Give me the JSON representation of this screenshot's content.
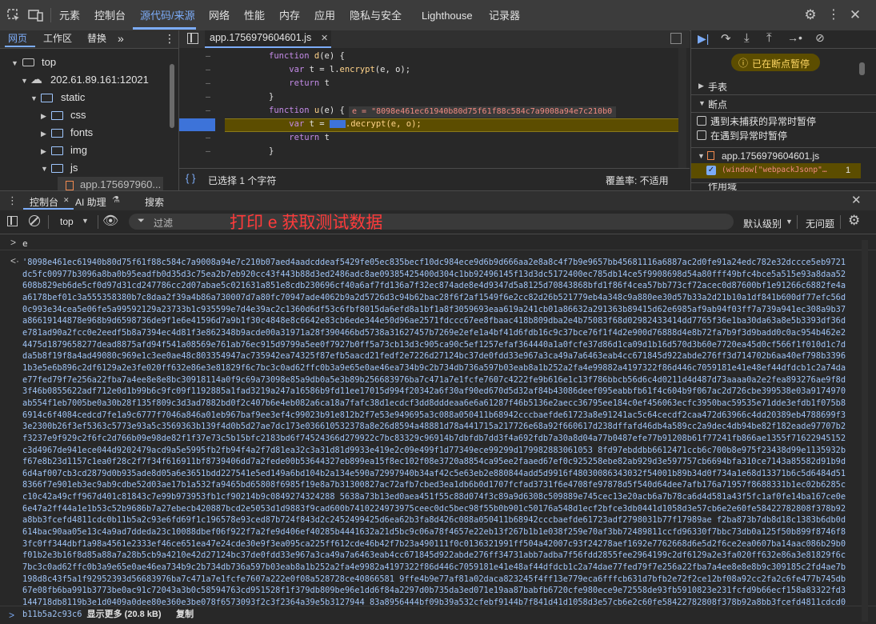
{
  "top_tabs": [
    "元素",
    "控制台",
    "源代码/来源",
    "网络",
    "性能",
    "内存",
    "应用",
    "隐私与安全",
    "Lighthouse",
    "记录器"
  ],
  "nav_tabs": [
    "网页",
    "工作区",
    "替换"
  ],
  "tree": {
    "top": "top",
    "host": "202.61.89.161:12021",
    "static": "static",
    "css": "css",
    "fonts": "fonts",
    "img": "img",
    "js": "js",
    "file": "app.175697960..."
  },
  "editor": {
    "file_tab": "app.1756979604601.js",
    "lines": [
      {
        "kw": "function ",
        "fn": "d",
        "rest": "(e) {"
      },
      {
        "ind": "    ",
        "kw": "var ",
        "rest": "t = l.",
        "fn2": "encrypt",
        "rest2": "(e, o);"
      },
      {
        "ind": "    ",
        "kw": "return ",
        "rest": "t"
      },
      {
        "rest": "}"
      },
      {
        "kw": "function ",
        "fn": "u",
        "rest": "(e) {"
      },
      {
        "ind": "    ",
        "kw": "var ",
        "rest": "t = ",
        "rest2": ".decrypt(e, o);"
      },
      {
        "ind": "    ",
        "kw": "return ",
        "rest": "t"
      },
      {
        "rest": "}"
      }
    ],
    "inline_tip": "e = \"8098e461ec61940b80d75f61f88c584c7a9008a94e7c210b0",
    "status": "已选择 1 个字符",
    "coverage": "覆盖率: 不适用"
  },
  "debugger": {
    "paused": "已在断点暂停",
    "watch": "手表",
    "breakpoints": "断点",
    "pause_uncaught": "遇到未捕获的异常时暂停",
    "pause_caught": "在遇到异常时暂停",
    "bp_file": "app.1756979604601.js",
    "bp_code": "(window[\"webpackJsonp\"…",
    "bp_line": "1",
    "scope": "作用域"
  },
  "drawer": {
    "console": "控制台",
    "ai": "AI 助理",
    "search": "搜索"
  },
  "console_toolbar": {
    "context": "top",
    "filter": "过滤",
    "level": "默认级别",
    "issues": "无问题"
  },
  "annotation": "打印 e 获取测试数据",
  "console_input": "e",
  "result_value": "'8098e461ec61940b80d75f61f88c584c7a9008a94e7c210b07aed4aadcddeaf5429fe05ec835becf10dc984ece9d6b9d666aa2e8a8c4f7b9e9657bb45681116a6887ac2d0fe91a24edc782e32dccce5eb9721dc5fc00977b3096a8ba0b95eadfb0d35d3c75ea2b7eb920cc43f443b88d3ed2486adc8ae09385425400d304c1bb92496145f13d3dc5172400ec785db14ce5f9908698d54a80fff49bfc4bce5a515e93a8daa52608b829eb6de5cf0d97d31cd247786cc2d07abae5c021631a851e8cdb230696cf40a6af7fd136a7f32ec874ade8e4d9347d5a8125d70843868bfd1f86f4cea57bb773cf72acec0d87600bf1e91266c6882fe4aa6178bef01c3a555358380b7c8daa2f39a4b86a730007d7a80fc70947ade4062b9a2d5726d3c94b62bac28f6f2af1549f6e2cc82d26b521779eb4a348c9a880ee30d57b33a2d21b10a1df841b600df77efc56d0c993e34cea5e06fe5a99592129a23733b1c935599e7d4e39ac2c1360d6df53c6fbf8015da6efd8a1bf1a8f3059693eaa619a241cb01a86632a291363b89415d62e6985af9ab94f03ff7a739a941ec308a9b37a86619144878e968b9d6598736de9f1e6e41596d7a9b1f30c4848e8c6642e83cb6ede344e50d96ae2571fdccc67ee8fbaac418b809dba2e4b75083f68d02982433414dd7765f36e1ba30da63a8e5b3393df36de781ad90a2fcc0e2eedf5b8a7394ec4d81f3e862348b9acde00a31971a28f390466bd5738a31627457b7269e2efe1a4bf41d6fdb16c9c37bce76f1f4d2e900d76888d4e8b72fa7b9f3d9badd0c0ac954b462e24475d1879658277dead8875afd94f541a08569e761ab76ec915d9799a5ee0f7927b0ff5a73cb13d3c905ca90c5ef1257efaf364440a1a0fcfe37d86d1ca09d1b16d570d3b60e7720ea45d0cf566f1f010d1c7dda5b8f19f8a4ad49080c969e1c3ee0ae48c803354947ac735942ea74325f87efb5aacd21fedf2e7226d27124bc37de0fdd33e967a3ca49a7a6463eab4cc671845d922abde276ff3d714702b6aa40ef798b33961b3e5e6b896c2df6129a2e3fe020ff632e86e3e81829f6c7bc3c0ad62ffc0b3a9e65e0ae46ea734b9c2b734db736a597b03eab8a1b252a2fa4e99882a4197322f86d446c7059181e41e48ef44dfdcb1c2a74dae77fed79f7e256a22fba7a4ee8e8e8bc30918114a0f9c69a73098e85a9db0a5e3b89b256683976ba7c471a7e1fcfe7607c4222fe9b616e1c13f786bbcb56d6c4d0211d4d487d73aaaa0a2e2fea893276ae9f8d3f46b0855622adf712e0d1b99b6c9fc09f1192885a1fad3219a247a16586b9fd11ee17015d994f20342a6f30af90ed670d5d32af84b43086deef095eabbfb61f4c604b9f067ac2d726cbe399538e03a9174970ab554f1eb7005be0a30b28f135f809c3d3ad7882bd0f2c407b6e4eb082a6ca18a7fafc38d1ecdcf3dd8dddeaa6e6a61287f46b5136e2aecc36795ee184c0ef456063ecfc3950bac59535e71dde3efdb1f075b86914c6f4084cedcd7fe1a9c6777f7046a846a01eb967baf9ee3ef4c99023b91e812b2f7e53e949695a3c088a050411b68942cccbaefde61723a8e91241ac5c64cecdf2caa472d63966c4dd20389eb4788699f33e2300b26f3ef5363c5773e93a5c3569363b139f4d0b5d27ae7dc173e036610532378a8e26d8594a48881d78a441715a217726e68a92f660617d238dffafd46db4a589cc2a9dec4db94be82f182eade97707b2f3237e9f929c2f6fc2d766b09e98de82f1f37e73c5b15bfc2183bd6f74524366d279922c7bc83329c96914b7dbfdb7dd3f4a692fdb7a30a8d04a77b0487efe77b91208b61f77241fb866ae1355f71622945152c3d4967de941ece044d9202479acd9a5e5995fb2fb94f4a2f7d81ea32c3a31d81d9933e419e2c09e499f1d77349ece99299d179982883061053 8fd97ebddbb6612471ccb6c700b8e975f23438d99e1135932bf67e8b23d1157c1ea0f28c2f7f34f616911bf8739406dd7a2fede00b53644327eb899ea15f8ec102f08e3720a8854ca95ee2faaed67ef0c925258ebe82ab929d3e597757cb6694bfa310ce7143a85582d91b9d6d4af007cb3cd2879d0b935ade8d05a6e3651bdd227541e5ed149a6bd104b2a134e590a72997940b34af42c5e63eb2e880844add5d9916f48030086343032f54001b89b34d0f734a1e68d13371b6c5d6484d518366f7e901eb3ec9ab9cdbe52d03ae17b1a532fa9465bd65808f6985f19e8a7b31300827ac72afb7cbed3ea1db6b0d1707fcfad3731f6e4708fe97878d5f540d64dee7afb176a71957f8688331b1ec02b6285cc10c42a49cff967d401c81843c7e99b973953fb1cf90214b9c0849274324288 5638a73b13ed0aea451f55c88d074f3c89a9d6308c509889e745cec13e20acb6a7b78ca6d4d581a43f5fc1af0fe14ba167ce0e6e47a2ff44a1e1b53c52b9686b7a27ebecb420887bcd2e5053d1d9883f9cad600b7410224973975ceec0dc5bec98f55b0b901c50176a548d1ecf2bfce3db0441d1058d3e57cb6e2e60fe58422782808f378b92a8bb3fcefd4811cdc0b11b5a2c93e6fd69f1c196578e93ced87b724f843d2c2452499425d6ea62b3fa8d426c088a050411b68942cccbaefde61723adf2798031b77f17989ae f2ba873b7db8d18c1383b6db0d614bac90aa05e13c4a9ad7ddeda23c10088dbef06f922f7a2fe9d406ef40285b4441632a21d5bc9c06a78f4657e22eb13f267b1b1e038f259e70af3bb72489811ccfd96330f7bbc73db0a125f50b899f8746f83fc0ff344dbf1a98a4561e2333ef46ce651ea47e24cde30e9f3ea095ca225ff612cde46b42f7b23a490111f0c0136321991ff504a42007c93f24278aef1692e7762668d6e5d2f6ce2ea0607ba14aac086b29b0f01b2e3b16f8d85a88a7a28b5cb9a4210e42d27124bc37de0fdd33e967a3ca49a7a6463eab4cc671845d922abde276ff34731abb7adba7f56fdd2855fee2964199c2df6129a2e3fa020ff632e86a3e81829f6c7bc3c0ad62ffc0b3a9e65e0ae46ea734b9c2b734db736a597b03eab8a1b252a2fa4e9982a4197322f86d446c7059181e41e48af44dfdcb1c2a74dae77fed79f7e256a22fba7a4ee8e8e8b9c309185c2fd4ae7b198d8c43f5a1f92952393d56683976ba7c471a7e1fcfe7607a222e0f08a528728ce40866581 9ffe4b9e77af81a02daca823245f4ff13e779eca6fffcb631d7bfb2e72f2ce12bf08a92cc2fa2c6fe477b745db67e08fb6ba991b3773be0ac91c72043a3b0c58594763cd951528f1f379db809be96e1dd6f84a2297d0b735da3ed071e19aa87babfb6720cfe980ece9e72558de93fb5910823e231fcfd9b66ecf158a83322fd3144718db8119b3e1d0409a0dee80e360e3be078f6573093f2c3f2364a39e5b3127944 83a8956444bf09b39a532cfebf9144b7f841d41d1058d3e57cb6e2c60fe58422782808f378b92a8bb3fcefd4811cdcd0b11b5a2c93c6",
  "show_more": "显示更多 (20.8 kB)",
  "copy": "复制"
}
